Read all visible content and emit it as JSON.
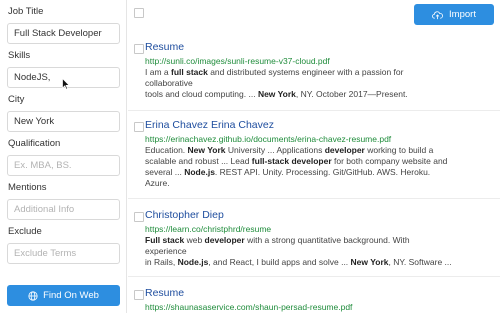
{
  "sidebar": {
    "job_title": {
      "label": "Job Title",
      "value": "Full Stack Developer"
    },
    "skills": {
      "label": "Skills",
      "value": "NodeJS,"
    },
    "city": {
      "label": "City",
      "value": "New York"
    },
    "qualification": {
      "label": "Qualification",
      "placeholder": "Ex. MBA, BS."
    },
    "mentions": {
      "label": "Mentions",
      "placeholder": "Additional Info"
    },
    "exclude": {
      "label": "Exclude",
      "placeholder": "Exclude Terms"
    },
    "find_button": "Find On Web"
  },
  "toolbar": {
    "import_label": "Import"
  },
  "results": [
    {
      "title": "Resume",
      "url": "http://sunli.co/images/sunli-resume-v37-cloud.pdf",
      "snippet_lines": [
        "I am a full stack and distributed systems engineer with a passion for",
        "collaborative",
        "tools and cloud computing. ... New York, NY. October 2017—Present."
      ]
    },
    {
      "title": "Erina Chavez Erina Chavez",
      "url": "https://erinachavez.github.io/documents/erina-chavez-resume.pdf",
      "snippet_lines": [
        "Education. New York University ... Applications developer working to build a",
        "scalable and robust ... Lead full-stack developer for both company website and",
        "several ... Node.js. REST API. Unity. Processing. Git/GitHub. AWS. Heroku.",
        "Azure."
      ]
    },
    {
      "title": "Christopher Diep",
      "url": "https://learn.co/christphrd/resume",
      "snippet_lines": [
        "Full stack web developer with a strong quantitative background. With",
        "experience",
        "in Rails, Node.js, and React, I build apps and solve ... New York, NY. Software ..."
      ]
    },
    {
      "title": "Resume",
      "url": "https://shaunasaservice.com/shaun-persad-resume.pdf",
      "snippet_lines": []
    }
  ]
}
